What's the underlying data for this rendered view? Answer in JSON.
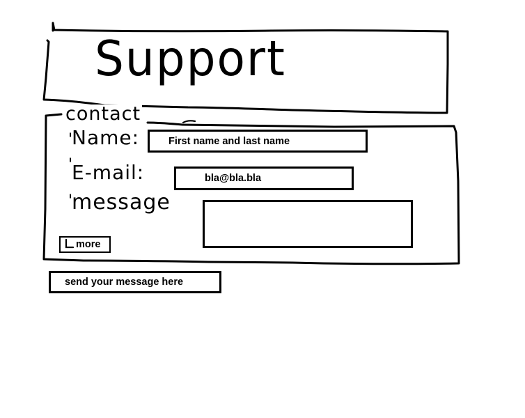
{
  "header": {
    "title": "Support"
  },
  "contact": {
    "legend": "contact",
    "name_label": "Name:",
    "name_value": "First name and last name",
    "email_label": "E-mail:",
    "email_value": "bla@bla.bla",
    "message_label": "message",
    "message_value": "",
    "more_label": "more",
    "required_marker": "'"
  },
  "footer": {
    "send_label": "send your message here"
  },
  "icons": {
    "more": "return-arrow-icon"
  }
}
